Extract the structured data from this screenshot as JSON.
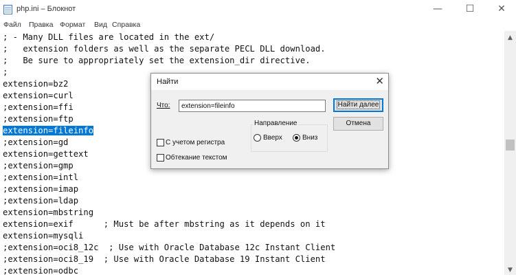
{
  "window": {
    "title": "php.ini – Блокнот",
    "icon": "notepad-icon",
    "controls": {
      "minimize": "—",
      "maximize": "☐",
      "close": "✕"
    }
  },
  "menu": [
    "Файл",
    "Правка",
    "Формат",
    "Вид",
    "Справка"
  ],
  "editor": {
    "lines": [
      "; - Many DLL files are located in the ext/",
      ";   extension folders as well as the separate PECL DLL download.",
      ";   Be sure to appropriately set the extension_dir directive.",
      ";",
      "extension=bz2",
      "extension=curl",
      ";extension=ffi",
      ";extension=ftp",
      "extension=fileinfo",
      ";extension=gd",
      "extension=gettext",
      ";extension=gmp",
      ";extension=intl",
      ";extension=imap",
      ";extension=ldap",
      "extension=mbstring",
      "extension=exif      ; Must be after mbstring as it depends on it",
      "extension=mysqli",
      ";extension=oci8_12c  ; Use with Oracle Database 12c Instant Client",
      ";extension=oci8_19  ; Use with Oracle Database 19 Instant Client",
      ";extension=odbc"
    ],
    "selected_line_index": 8
  },
  "find_dialog": {
    "title": "Найти",
    "close": "✕",
    "find_label": "Что:",
    "find_value": "extension=fileinfo",
    "find_next_button": "Найти далее",
    "cancel_button": "Отмена",
    "direction_label": "Направление",
    "up_label": "Вверх",
    "down_label": "Вниз",
    "direction_selected": "down",
    "match_case_label": "С учетом регистра",
    "wrap_label": "Обтекание текстом",
    "match_case_checked": false,
    "wrap_checked": false
  }
}
